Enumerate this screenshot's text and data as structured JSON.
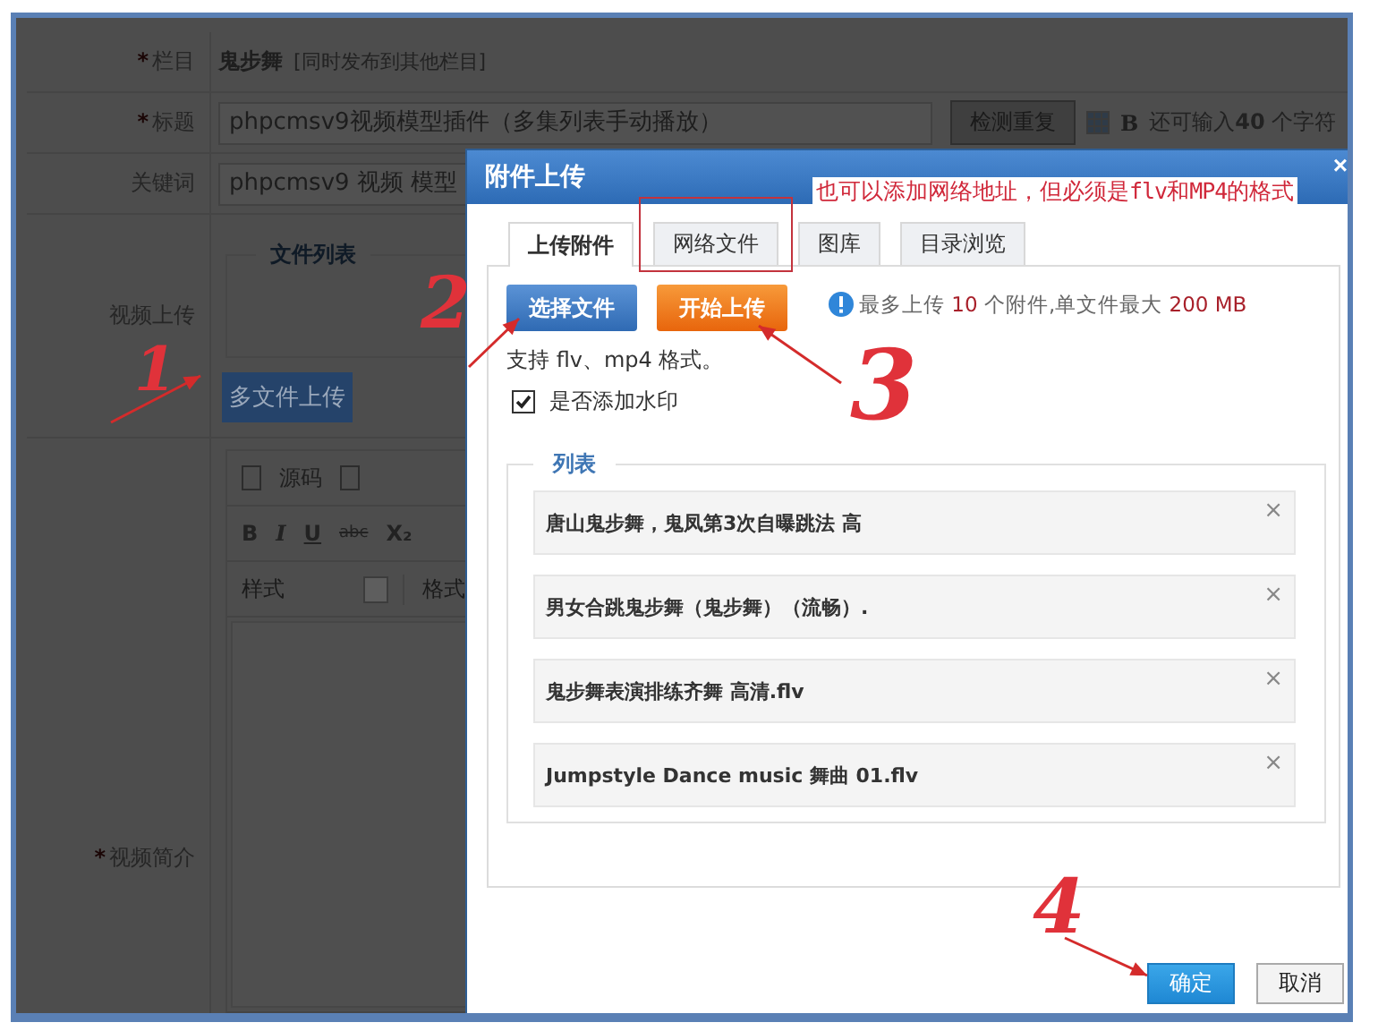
{
  "form": {
    "rows": [
      {
        "label": "栏目",
        "mark": "*",
        "value": "鬼步舞",
        "hint": "[同时发布到其他栏目]",
        "kind": "text"
      },
      {
        "label": "标题",
        "mark": "*",
        "value": "phpcmsv9视频模型插件（多集列表手动播放）",
        "button": "检测重复",
        "bold_mark": "B",
        "counter": "还可输入**40** 个字符",
        "kind": "input"
      },
      {
        "label": "关键词",
        "value": "phpcmsv9 视频 模型",
        "kind": "input"
      }
    ],
    "video_upload": {
      "label": "视频上传",
      "legend": "文件列表",
      "button": "多文件上传"
    },
    "editor": {
      "label": "视频简介",
      "mark": "*",
      "source": "源码",
      "format_buttons": [
        "B",
        "I",
        "U",
        "abc",
        "X₂"
      ],
      "style": "样式",
      "format": "格式"
    }
  },
  "dialog": {
    "title": "附件上传",
    "close": "×",
    "note": "也可以添加网络地址，但必须是flv和MP4的格式",
    "tabs": [
      {
        "label": "上传附件",
        "selected": true,
        "highlighted": false
      },
      {
        "label": "网络文件",
        "selected": false,
        "highlighted": true
      },
      {
        "label": "图库",
        "selected": false,
        "highlighted": false
      },
      {
        "label": "目录浏览",
        "selected": false,
        "highlighted": false
      }
    ],
    "select_button": "选择文件",
    "start_button": "开始上传",
    "info": {
      "prefix": "最多上传",
      "count": "10",
      "middle": "个附件,单文件最大",
      "size": "200 MB"
    },
    "support": "支持 flv、mp4 格式。",
    "watermark": {
      "label": "是否添加水印",
      "checked": true
    },
    "list_legend": "列表",
    "files": [
      {
        "name": "唐山鬼步舞，鬼凤第3次自曝跳法 高",
        "remove": "×"
      },
      {
        "name": "男女合跳鬼步舞（鬼步舞）（流畅）.",
        "remove": "×"
      },
      {
        "name": "鬼步舞表演排练齐舞 高清.flv",
        "remove": "×"
      },
      {
        "name": "Jumpstyle Dance  music 舞曲  01.flv",
        "remove": "×"
      }
    ],
    "ok": "确定",
    "cancel": "取消"
  },
  "annotations": [
    "1",
    "2",
    "3",
    "4"
  ]
}
